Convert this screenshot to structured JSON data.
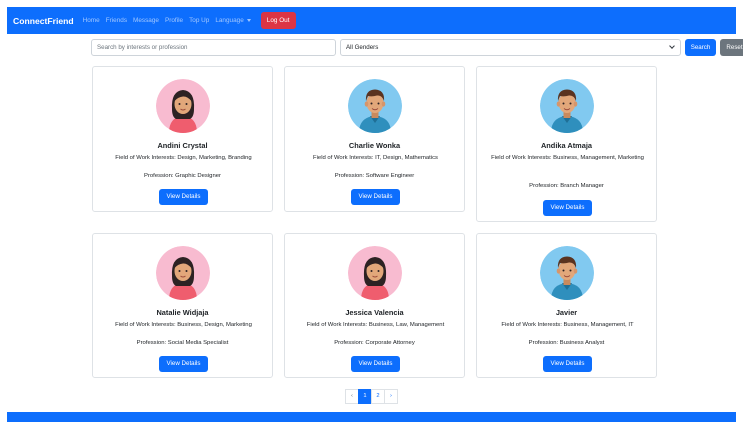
{
  "navbar": {
    "brand": "ConnectFriend",
    "links": [
      "Home",
      "Friends",
      "Message",
      "Profile",
      "Top Up",
      "Language"
    ],
    "logout": "Log Out"
  },
  "search": {
    "placeholder": "Search by interests or profession",
    "gender_selected": "All Genders",
    "search_button": "Search",
    "reset_button": "Reset"
  },
  "cards": [
    {
      "name": "Andini Crystal",
      "interests": "Field of Work Interests: Design, Marketing, Branding",
      "profession": "Profession: Graphic Designer",
      "button": "View Details",
      "avatar": "female"
    },
    {
      "name": "Charlie Wonka",
      "interests": "Field of Work Interests: IT, Design, Mathematics",
      "profession": "Profession: Software Engineer",
      "button": "View Details",
      "avatar": "male"
    },
    {
      "name": "Andika Atmaja",
      "interests": "Field of Work Interests: Business, Management, Marketing",
      "profession": "Profession: Branch Manager",
      "button": "View Details",
      "avatar": "male"
    },
    {
      "name": "Natalie Widjaja",
      "interests": "Field of Work Interests: Business, Design, Marketing",
      "profession": "Profession: Social Media Specialist",
      "button": "View Details",
      "avatar": "female"
    },
    {
      "name": "Jessica Valencia",
      "interests": "Field of Work Interests: Business, Law, Management",
      "profession": "Profession: Corporate Attorney",
      "button": "View Details",
      "avatar": "female"
    },
    {
      "name": "Javier",
      "interests": "Field of Work Interests: Business, Management, IT",
      "profession": "Profession: Business Analyst",
      "button": "View Details",
      "avatar": "male"
    }
  ],
  "pagination": {
    "prev": "‹",
    "pages": [
      "1",
      "2"
    ],
    "active": "1",
    "next": "›"
  },
  "colors": {
    "primary": "#0d6efd",
    "danger": "#dc3545",
    "secondary": "#6c757d",
    "female_bg": "#f8bbd0",
    "male_bg": "#81c9f0"
  }
}
